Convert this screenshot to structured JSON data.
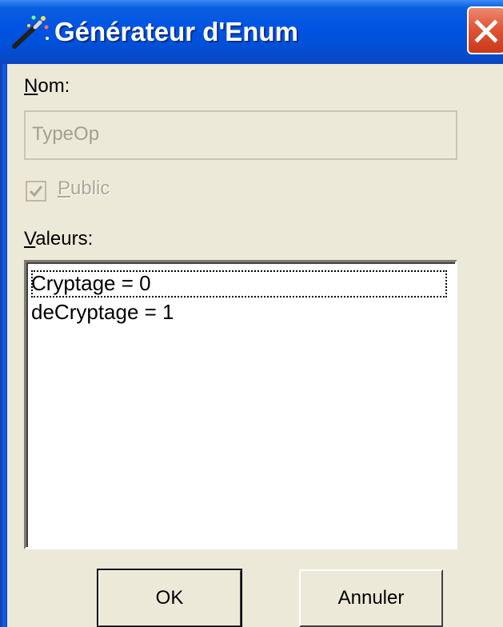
{
  "window": {
    "title": "Générateur d'Enum",
    "close_icon": "close-icon"
  },
  "nom": {
    "label_accel": "N",
    "label_rest": "om:",
    "value": "TypeOp",
    "disabled": true
  },
  "public": {
    "label_accel": "P",
    "label_rest": "ublic",
    "checked": true,
    "disabled": true
  },
  "valeurs": {
    "label_accel": "V",
    "label_rest": "aleurs:",
    "items": [
      "Cryptage = 0",
      "deCryptage = 1"
    ],
    "focused_index": 0
  },
  "buttons": {
    "ok": "OK",
    "cancel": "Annuler"
  },
  "colors": {
    "titlebar": "#0054e3",
    "close": "#e05535",
    "dialog_bg": "#ece9d8"
  }
}
